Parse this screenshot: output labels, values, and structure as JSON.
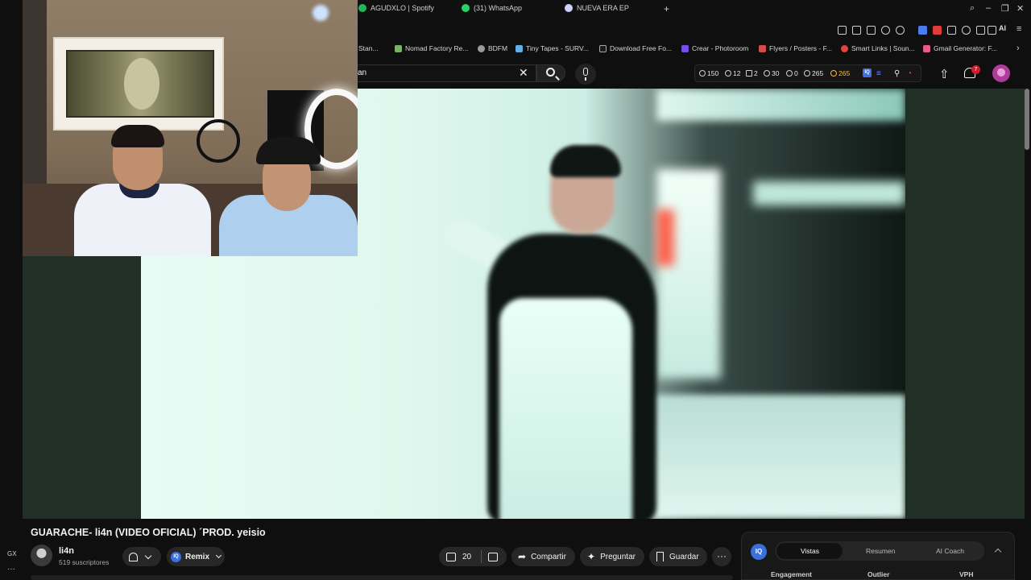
{
  "browser": {
    "tabs": [
      {
        "label": "AGUDXLO | Spotify",
        "color": "#1db954"
      },
      {
        "label": "(31) WhatsApp",
        "color": "#25d366"
      },
      {
        "label": "NUEVA ERA EP",
        "color": "#d0d0ff"
      }
    ],
    "toolbar_ai_label": "AI",
    "bookmarks": [
      {
        "label": "Stan..."
      },
      {
        "label": "Nomad Factory Re..."
      },
      {
        "label": "BDFM"
      },
      {
        "label": "Tiny Tapes - SURV..."
      },
      {
        "label": "Download Free Fo..."
      },
      {
        "label": "Crear - Photoroom"
      },
      {
        "label": "Flyers / Posters - F..."
      },
      {
        "label": "Smart Links | Soun..."
      },
      {
        "label": "Gmail Generator: F..."
      }
    ]
  },
  "header": {
    "search_value": "an",
    "notification_count": "7"
  },
  "stats": {
    "items": [
      {
        "value": "150",
        "icon": "clock-icon"
      },
      {
        "value": "12",
        "icon": "eye-icon"
      },
      {
        "value": "2",
        "icon": "bolt-icon"
      },
      {
        "value": "30",
        "icon": "eye-icon"
      },
      {
        "value": "0",
        "icon": "timer-icon"
      },
      {
        "value": "265",
        "icon": "user-icon"
      },
      {
        "value": "265",
        "icon": "user-icon"
      }
    ],
    "iq_label": "IQ"
  },
  "video": {
    "title": "GUARACHE- li4n (VIDEO OFICIAL) ´PROD. yeisio",
    "channel_name": "li4n",
    "subscribers": "519 suscriptores",
    "remix_label": "Remix",
    "likes": "20",
    "share_label": "Compartir",
    "ask_label": "Preguntar",
    "save_label": "Guardar"
  },
  "iq_panel": {
    "logo": "IQ",
    "tabs": [
      "Vistas",
      "Resumen",
      "AI Coach"
    ],
    "active_tab": "Vistas",
    "columns": [
      "Engagement",
      "Outlier",
      "VPH"
    ]
  },
  "sidebar": {
    "gx_label": "GX",
    "more_label": "···"
  }
}
